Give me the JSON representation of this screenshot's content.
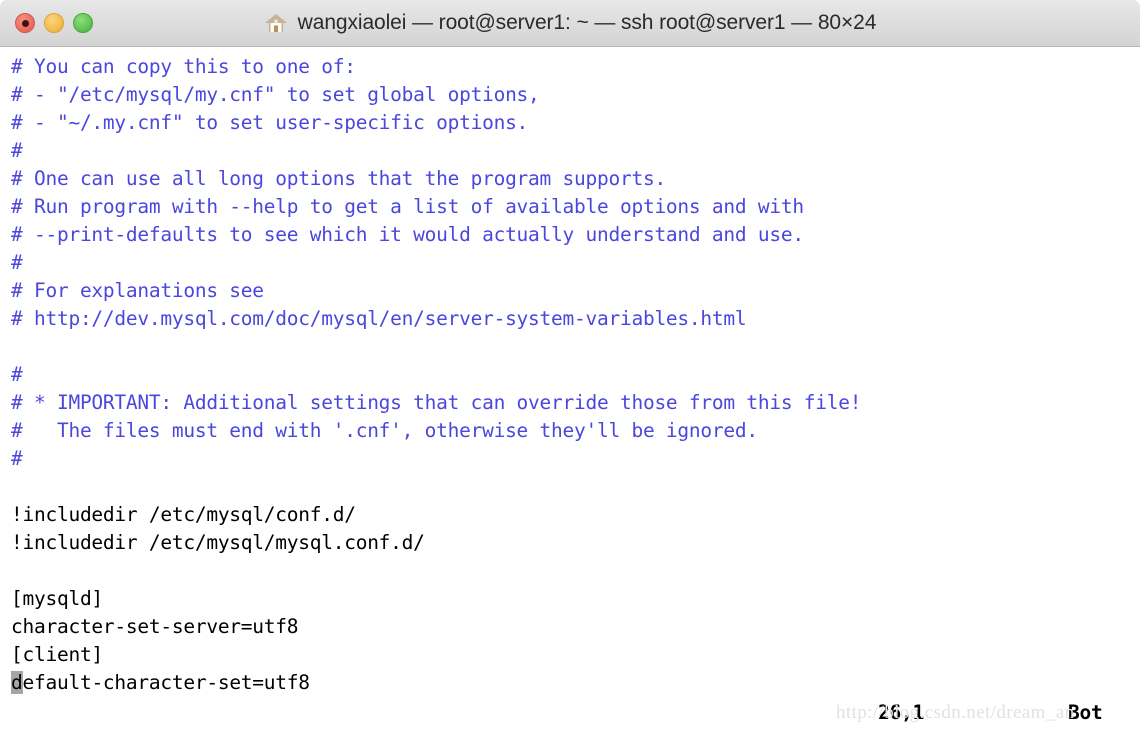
{
  "window": {
    "title": "wangxiaolei — root@server1: ~ — ssh root@server1 — 80×24",
    "home_icon": "home-icon",
    "controls": {
      "close": "close-button",
      "minimize": "minimize-button",
      "maximize": "maximize-button"
    }
  },
  "colors": {
    "comment_blue": "#4b47dd",
    "text_black": "#000000",
    "cursor_gray": "#a6a6a6",
    "titlebar_top": "#e8e8e8",
    "titlebar_bottom": "#d4d4d4",
    "traffic_red": "#ec6d61",
    "traffic_yellow": "#f5bd4f",
    "traffic_green": "#61c454",
    "watermark_gray": "#e2e2e2"
  },
  "terminal": {
    "lines": [
      {
        "text": "# You can copy this to one of:",
        "style": "comment"
      },
      {
        "text": "# - \"/etc/mysql/my.cnf\" to set global options,",
        "style": "comment"
      },
      {
        "text": "# - \"~/.my.cnf\" to set user-specific options.",
        "style": "comment"
      },
      {
        "text": "#",
        "style": "comment"
      },
      {
        "text": "# One can use all long options that the program supports.",
        "style": "comment"
      },
      {
        "text": "# Run program with --help to get a list of available options and with",
        "style": "comment"
      },
      {
        "text": "# --print-defaults to see which it would actually understand and use.",
        "style": "comment"
      },
      {
        "text": "#",
        "style": "comment"
      },
      {
        "text": "# For explanations see",
        "style": "comment"
      },
      {
        "text": "# http://dev.mysql.com/doc/mysql/en/server-system-variables.html",
        "style": "comment"
      },
      {
        "text": "",
        "style": "plain"
      },
      {
        "text": "#",
        "style": "comment"
      },
      {
        "text": "# * IMPORTANT: Additional settings that can override those from this file!",
        "style": "comment"
      },
      {
        "text": "#   The files must end with '.cnf', otherwise they'll be ignored.",
        "style": "comment"
      },
      {
        "text": "#",
        "style": "comment"
      },
      {
        "text": "",
        "style": "plain"
      },
      {
        "text": "!includedir /etc/mysql/conf.d/",
        "style": "plain"
      },
      {
        "text": "!includedir /etc/mysql/mysql.conf.d/",
        "style": "plain"
      },
      {
        "text": "",
        "style": "plain"
      },
      {
        "text": "[mysqld]",
        "style": "plain"
      },
      {
        "text": "character-set-server=utf8",
        "style": "plain"
      },
      {
        "text": "[client]",
        "style": "plain"
      }
    ],
    "cursor_line": {
      "cursor_char": "d",
      "rest": "efault-character-set=utf8",
      "style": "plain"
    }
  },
  "status": {
    "position": "26,1",
    "scroll": "Bot"
  },
  "watermark": {
    "text": "http://blog.csdn.net/dream_an"
  }
}
